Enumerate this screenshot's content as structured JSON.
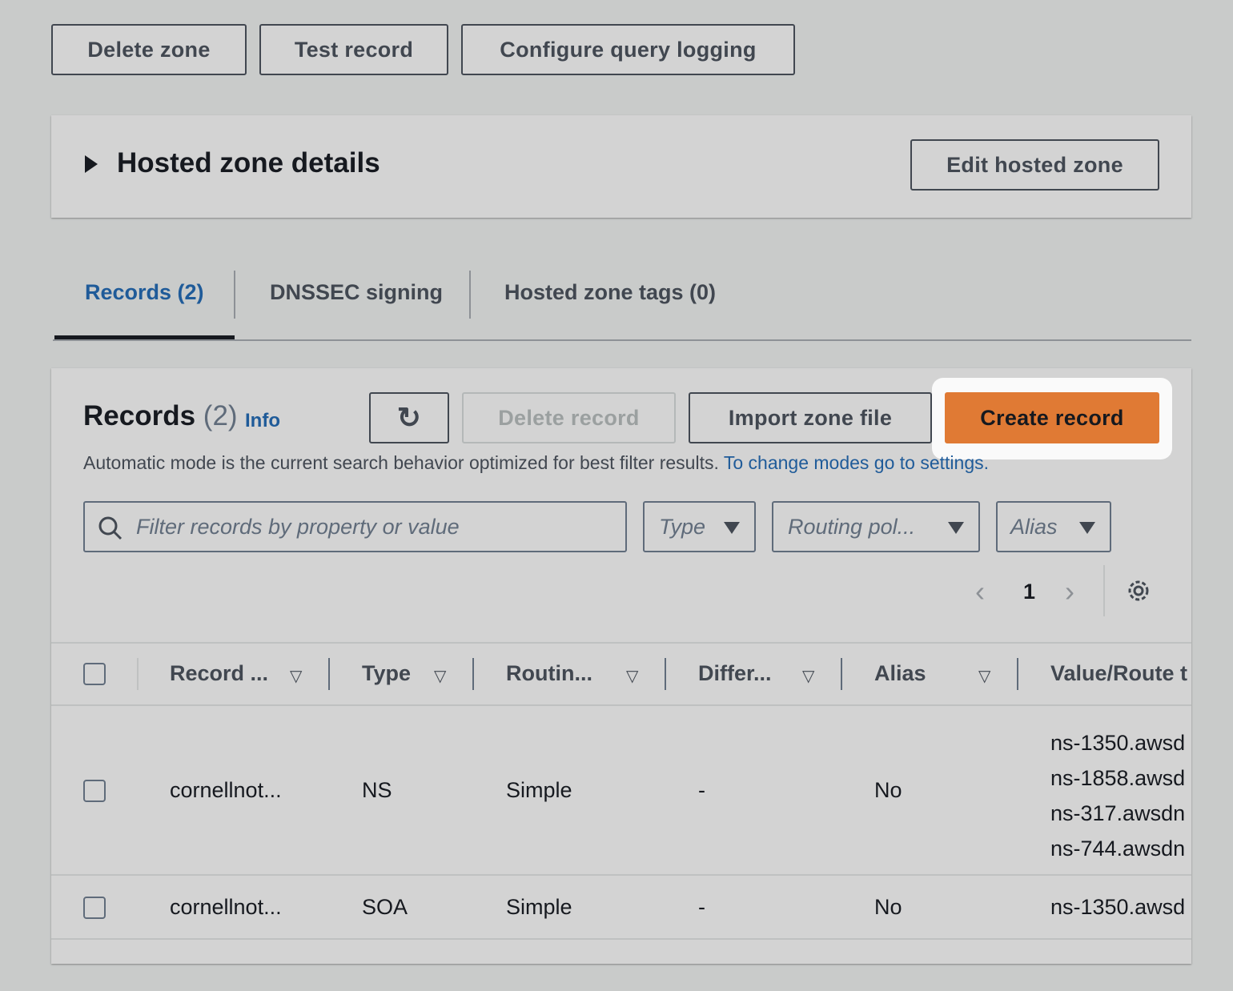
{
  "top_actions": {
    "delete_zone": "Delete zone",
    "test_record": "Test record",
    "configure_logging": "Configure query logging"
  },
  "details": {
    "title": "Hosted zone details",
    "edit": "Edit hosted zone"
  },
  "tabs": [
    {
      "label": "Records (2)",
      "active": true
    },
    {
      "label": "DNSSEC signing"
    },
    {
      "label": "Hosted zone tags (0)"
    }
  ],
  "records": {
    "title": "Records",
    "count": "(2)",
    "info": "Info",
    "delete": "Delete record",
    "import": "Import zone file",
    "create": "Create record",
    "description": "Automatic mode is the current search behavior optimized for best filter results.",
    "settings_link": "To change modes go to settings.",
    "search_placeholder": "Filter records by property or value",
    "filters": {
      "type": "Type",
      "routing": "Routing pol...",
      "alias": "Alias"
    },
    "page": "1",
    "columns": [
      "Record ...",
      "Type",
      "Routin...",
      "Differ...",
      "Alias",
      "Value/Route t"
    ],
    "rows": [
      {
        "name": "cornellnot...",
        "type": "NS",
        "routing": "Simple",
        "differ": "-",
        "alias": "No",
        "values": [
          "ns-1350.awsd",
          "ns-1858.awsd",
          "ns-317.awsdn",
          "ns-744.awsdn"
        ]
      },
      {
        "name": "cornellnot...",
        "type": "SOA",
        "routing": "Simple",
        "differ": "-",
        "alias": "No",
        "values": [
          "ns-1350.awsd"
        ]
      }
    ]
  },
  "colors": {
    "accent": "#e07a34",
    "link": "#1f5b99"
  }
}
